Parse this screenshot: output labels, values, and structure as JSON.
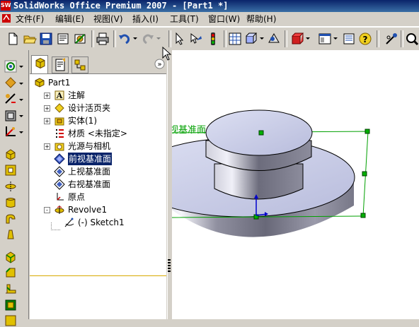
{
  "window": {
    "title": "SolidWorks Office Premium 2007 - [Part1 *]",
    "app_icon_text": "SW"
  },
  "menu": [
    {
      "label": "文件(F)"
    },
    {
      "label": "编辑(E)"
    },
    {
      "label": "视图(V)"
    },
    {
      "label": "插入(I)"
    },
    {
      "label": "工具(T)"
    },
    {
      "label": "窗口(W)"
    },
    {
      "label": "帮助(H)"
    }
  ],
  "toolbar": {
    "icons": [
      "new-icon",
      "open-icon",
      "save-icon",
      "print-preview-icon",
      "options-icon",
      "print-icon",
      "undo-icon",
      "redo-icon",
      "select-icon",
      "select-other-icon",
      "rebuild-icon",
      "grid-icon",
      "view-orientation-icon",
      "display-style-icon",
      "appearance-icon",
      "section-view-icon",
      "properties-icon",
      "help-icon",
      "sketch-icon",
      "zoom-icon"
    ]
  },
  "left_toolbar": {
    "icons": [
      "sketch-tool-icon",
      "smart-dimension-icon",
      "relations-icon",
      "planes-icon",
      "axis-icon",
      "extrude-boss-icon",
      "extrude-cut-icon",
      "revolve-icon",
      "loft-icon",
      "sweep-icon",
      "shell-icon",
      "fillet-icon",
      "chamfer-icon",
      "rib-icon",
      "draft-icon",
      "mirror-icon"
    ]
  },
  "feature_manager": {
    "tabs": [
      "feature-tree-tab",
      "property-manager-tab",
      "configuration-manager-tab"
    ],
    "collapse_glyph": "»",
    "tree": [
      {
        "label": "Part1",
        "icon": "part-icon",
        "expander": "",
        "indent": 0,
        "selected": false
      },
      {
        "label": "注解",
        "icon": "annotations-icon",
        "expander": "+",
        "indent": 1,
        "selected": false
      },
      {
        "label": "设计活页夹",
        "icon": "design-binder-icon",
        "expander": "+",
        "indent": 1,
        "selected": false
      },
      {
        "label": "实体(1)",
        "icon": "solid-bodies-icon",
        "expander": "+",
        "indent": 1,
        "selected": false
      },
      {
        "label": "材质 <未指定>",
        "icon": "material-icon",
        "expander": "",
        "indent": 1,
        "selected": false
      },
      {
        "label": "光源与相机",
        "icon": "lights-cameras-icon",
        "expander": "+",
        "indent": 1,
        "selected": false
      },
      {
        "label": "前视基准面",
        "icon": "plane-icon",
        "expander": "",
        "indent": 1,
        "selected": true
      },
      {
        "label": "上视基准面",
        "icon": "plane-icon",
        "expander": "",
        "indent": 1,
        "selected": false
      },
      {
        "label": "右视基准面",
        "icon": "plane-icon",
        "expander": "",
        "indent": 1,
        "selected": false
      },
      {
        "label": "原点",
        "icon": "origin-icon",
        "expander": "",
        "indent": 1,
        "selected": false
      },
      {
        "label": "Revolve1",
        "icon": "revolve-feature-icon",
        "expander": "-",
        "indent": 1,
        "selected": false
      },
      {
        "label": "(-) Sketch1",
        "icon": "sketch-feature-icon",
        "expander": "",
        "indent": 2,
        "selected": false
      }
    ]
  },
  "graphics": {
    "plane_label": "视基准面",
    "colors": {
      "plane_highlight": "#00a000",
      "part_face": "#c8cce8",
      "part_side": "#9a9aa8",
      "origin": "#0000cc"
    }
  },
  "colors": {
    "title_bar": "#0a246a",
    "chrome": "#d4d0c8",
    "selection": "#0a246a",
    "tree_underline": "#d8a800"
  }
}
